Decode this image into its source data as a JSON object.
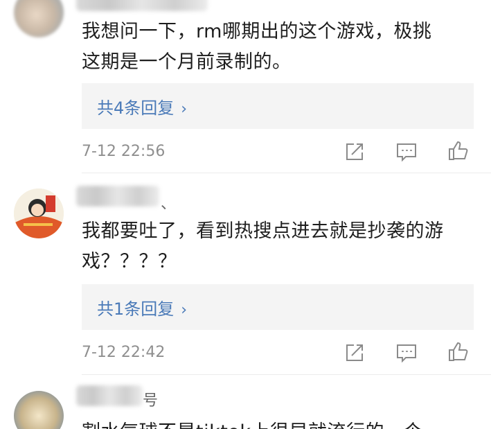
{
  "comments": [
    {
      "text_line1": "我想问一下，rm哪期出的这个游戏，极挑",
      "text_line2": "这期是一个月前录制的。",
      "reply_label": "共4条回复",
      "reply_arrow": "›",
      "timestamp": "7-12 22:56",
      "icons": [
        "share-icon",
        "comment-icon",
        "like-icon"
      ]
    },
    {
      "username_suffix": "、",
      "text_line1": "我都要吐了，看到热搜点进去就是抄袭的游",
      "text_line2": "戏？？？？",
      "reply_label": "共1条回复",
      "reply_arrow": "›",
      "timestamp": "7-12 22:42",
      "icons": [
        "share-icon",
        "comment-icon",
        "like-icon"
      ]
    },
    {
      "username_suffix": "号",
      "text_line1": "割水气球不是tiktok上很早就流行的一个"
    }
  ],
  "colors": {
    "reply_link": "#4a7ab8",
    "reply_bg": "#f4f4f4",
    "timestamp": "#8f8f8f",
    "icon": "#8a8a8a"
  }
}
